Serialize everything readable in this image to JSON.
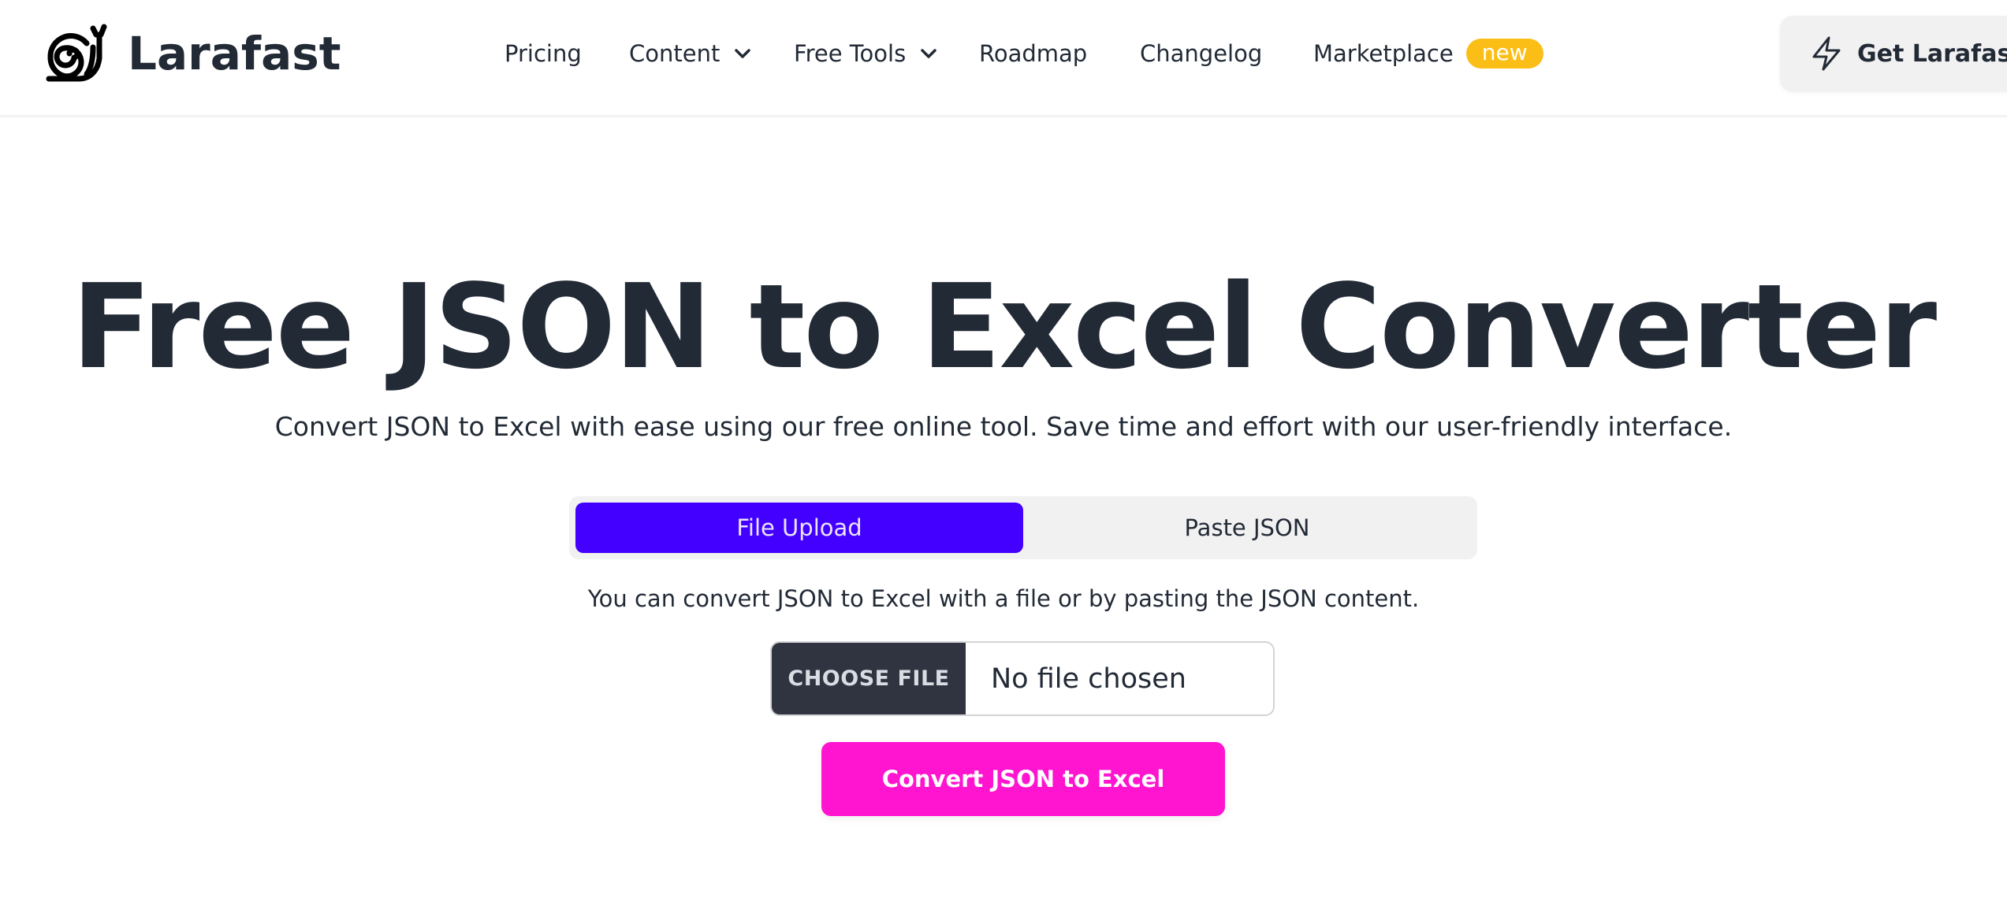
{
  "header": {
    "brand": "Larafast",
    "nav": [
      {
        "label": "Pricing",
        "has_dropdown": false
      },
      {
        "label": "Content",
        "has_dropdown": true
      },
      {
        "label": "Free Tools",
        "has_dropdown": true
      },
      {
        "label": "Roadmap",
        "has_dropdown": false
      },
      {
        "label": "Changelog",
        "has_dropdown": false
      },
      {
        "label": "Marketplace",
        "has_dropdown": false,
        "badge": "new"
      }
    ],
    "cta_label": "Get Larafast",
    "cta_icon": "lightning-icon",
    "logo_icon": "snail-icon"
  },
  "main": {
    "title": "Free JSON to Excel Converter",
    "subtitle": "Convert JSON to Excel with ease using our free online tool. Save time and effort with our user-friendly interface.",
    "tabs": [
      {
        "label": "File Upload",
        "active": true
      },
      {
        "label": "Paste JSON",
        "active": false
      }
    ],
    "helper_text": "You can convert JSON to Excel with a file or by pasting the JSON content.",
    "file_input": {
      "button_label": "CHOOSE FILE",
      "status": "No file chosen"
    },
    "convert_label": "Convert JSON to Excel"
  },
  "colors": {
    "text": "#222a36",
    "active_tab": "#4400ff",
    "convert_button": "#ff14cf",
    "badge": "#fbbe17",
    "choose_file_button": "#2f3440"
  }
}
